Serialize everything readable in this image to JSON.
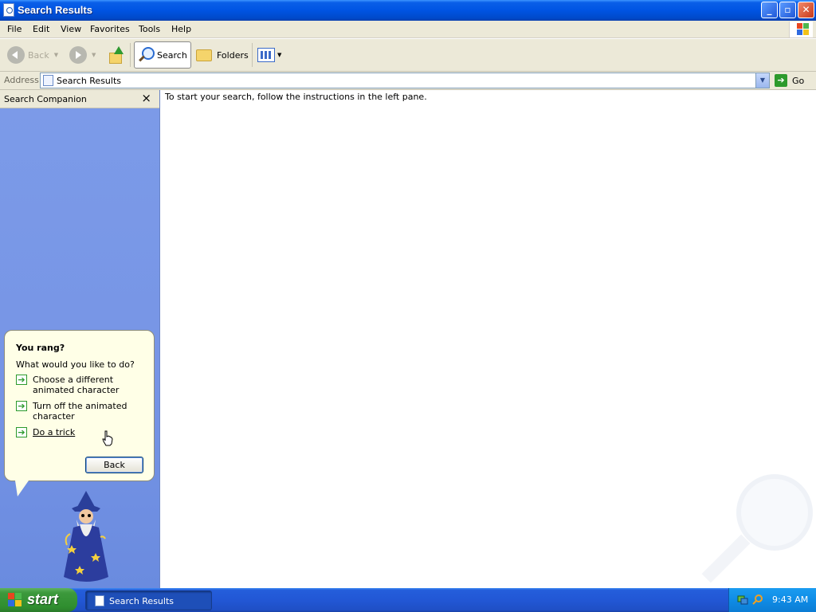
{
  "window": {
    "title": "Search Results"
  },
  "menu": [
    "File",
    "Edit",
    "View",
    "Favorites",
    "Tools",
    "Help"
  ],
  "toolbar": {
    "back_label": "Back",
    "search_label": "Search",
    "folders_label": "Folders"
  },
  "address": {
    "label": "Address",
    "value": "Search Results",
    "go_label": "Go"
  },
  "search_companion": {
    "title": "Search Companion",
    "close_glyph": "×",
    "balloon": {
      "title": "You rang?",
      "question": "What would you like to do?",
      "options": [
        {
          "label": "Choose a different animated character"
        },
        {
          "label": "Turn off the animated character"
        },
        {
          "label": "Do a trick"
        }
      ],
      "back_label": "Back"
    }
  },
  "main": {
    "message": "To start your search, follow the instructions in the left pane."
  },
  "taskbar": {
    "start_label": "start",
    "task_item": "Search Results",
    "clock": "9:43 AM"
  },
  "colors": {
    "title_blue": "#0054e3",
    "pane_blue": "#7c9be8",
    "taskbar_blue": "#245edb",
    "start_green": "#3c993c"
  }
}
